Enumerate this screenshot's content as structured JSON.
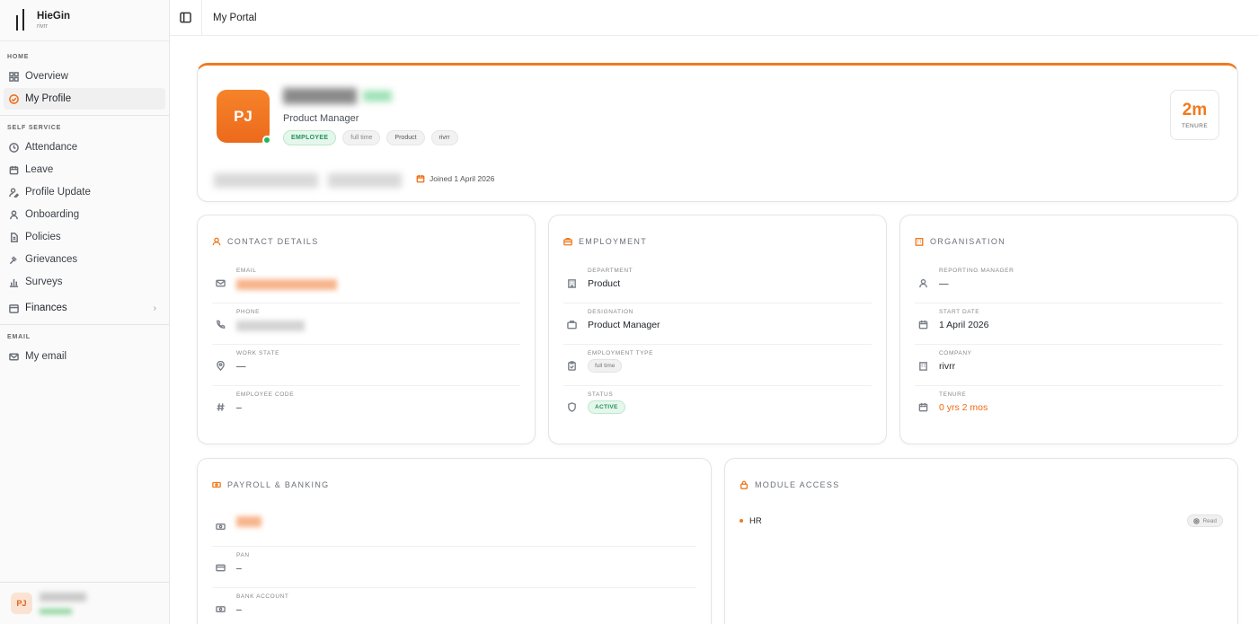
{
  "brand": {
    "name": "HieGin",
    "sub": "rivrr"
  },
  "sidebar": {
    "sections": [
      {
        "label": "HOME",
        "items": [
          {
            "label": "Overview",
            "icon": "grid-icon"
          },
          {
            "label": "My Profile",
            "icon": "user-circle-icon",
            "active": true
          }
        ]
      },
      {
        "label": "SELF SERVICE",
        "items": [
          {
            "label": "Attendance",
            "icon": "clock-icon"
          },
          {
            "label": "Leave",
            "icon": "calendar-icon"
          },
          {
            "label": "Profile Update",
            "icon": "user-edit-icon"
          },
          {
            "label": "Onboarding",
            "icon": "user-plus-icon"
          },
          {
            "label": "Policies",
            "icon": "document-icon"
          },
          {
            "label": "Grievances",
            "icon": "gavel-icon"
          },
          {
            "label": "Surveys",
            "icon": "bar-chart-icon"
          },
          {
            "label": "Finances",
            "icon": "wallet-icon"
          }
        ]
      },
      {
        "label": "EMAIL",
        "items": [
          {
            "label": "My email",
            "icon": "mail-icon"
          }
        ]
      }
    ],
    "footer": {
      "initials": "PJ"
    }
  },
  "header": {
    "title": "My Portal"
  },
  "profile": {
    "initials": "PJ",
    "role": "Product Manager",
    "chips": [
      "EMPLOYEE",
      "full time",
      "Product",
      "rivrr"
    ],
    "joined": "Joined 1 April 2026",
    "tenure": {
      "value": "2m",
      "label": "TENURE"
    }
  },
  "contact": {
    "title": "CONTACT DETAILS",
    "fields": [
      {
        "label": "EMAIL"
      },
      {
        "label": "PHONE"
      },
      {
        "label": "WORK STATE",
        "value": "—"
      },
      {
        "label": "EMPLOYEE CODE",
        "value": "–"
      }
    ]
  },
  "employment": {
    "title": "EMPLOYMENT",
    "fields": [
      {
        "label": "DEPARTMENT",
        "value": "Product"
      },
      {
        "label": "DESIGNATION",
        "value": "Product Manager"
      },
      {
        "label": "EMPLOYMENT TYPE",
        "value": "full time"
      },
      {
        "label": "STATUS",
        "value": "ACTIVE"
      }
    ]
  },
  "organisation": {
    "title": "ORGANISATION",
    "fields": [
      {
        "label": "REPORTING MANAGER",
        "value": "—"
      },
      {
        "label": "START DATE",
        "value": "1 April 2026"
      },
      {
        "label": "COMPANY",
        "value": "rivrr"
      },
      {
        "label": "TENURE",
        "value": "0 yrs 2 mos"
      }
    ]
  },
  "payroll": {
    "title": "PAYROLL & BANKING",
    "fields": [
      {
        "label": ""
      },
      {
        "label": "PAN",
        "value": "–"
      },
      {
        "label": "BANK ACCOUNT",
        "value": "–"
      }
    ]
  },
  "modules": {
    "title": "MODULE ACCESS",
    "items": [
      {
        "name": "HR",
        "permission": "Read"
      }
    ]
  },
  "colors": {
    "accent": "#ef7a1f",
    "success": "#22b55a"
  }
}
